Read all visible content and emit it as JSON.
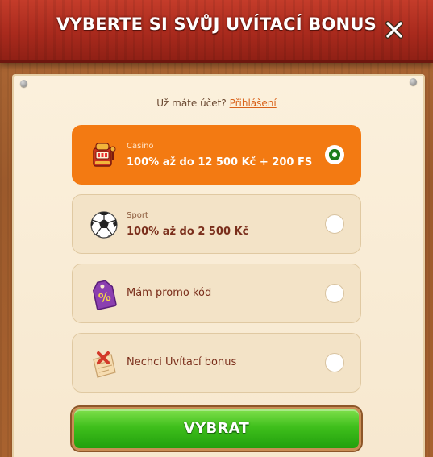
{
  "header": {
    "title": "VYBERTE SI SVŮJ UVÍTACÍ BONUS",
    "close_icon": "close-icon"
  },
  "login": {
    "prompt": "Už máte účet?",
    "link_label": "Přihlášení"
  },
  "options": [
    {
      "category": "Casino",
      "label": "100% až do 12 500 Kč + 200 FS",
      "icon": "slot-machine-icon",
      "selected": true
    },
    {
      "category": "Sport",
      "label": "100% až do 2 500 Kč",
      "icon": "soccer-ball-icon",
      "selected": false
    },
    {
      "category": "",
      "label": "Mám promo kód",
      "icon": "percent-tag-icon",
      "selected": false
    },
    {
      "category": "",
      "label": "Nechci Uvítací bonus",
      "icon": "no-bonus-scroll-icon",
      "selected": false
    }
  ],
  "submit": {
    "label": "VYBRAT"
  },
  "colors": {
    "header_red": "#a92a1d",
    "active_orange": "#f37a12",
    "button_green": "#3fbf1c",
    "paper": "#fbf0dc",
    "link_orange": "#d9621a"
  }
}
